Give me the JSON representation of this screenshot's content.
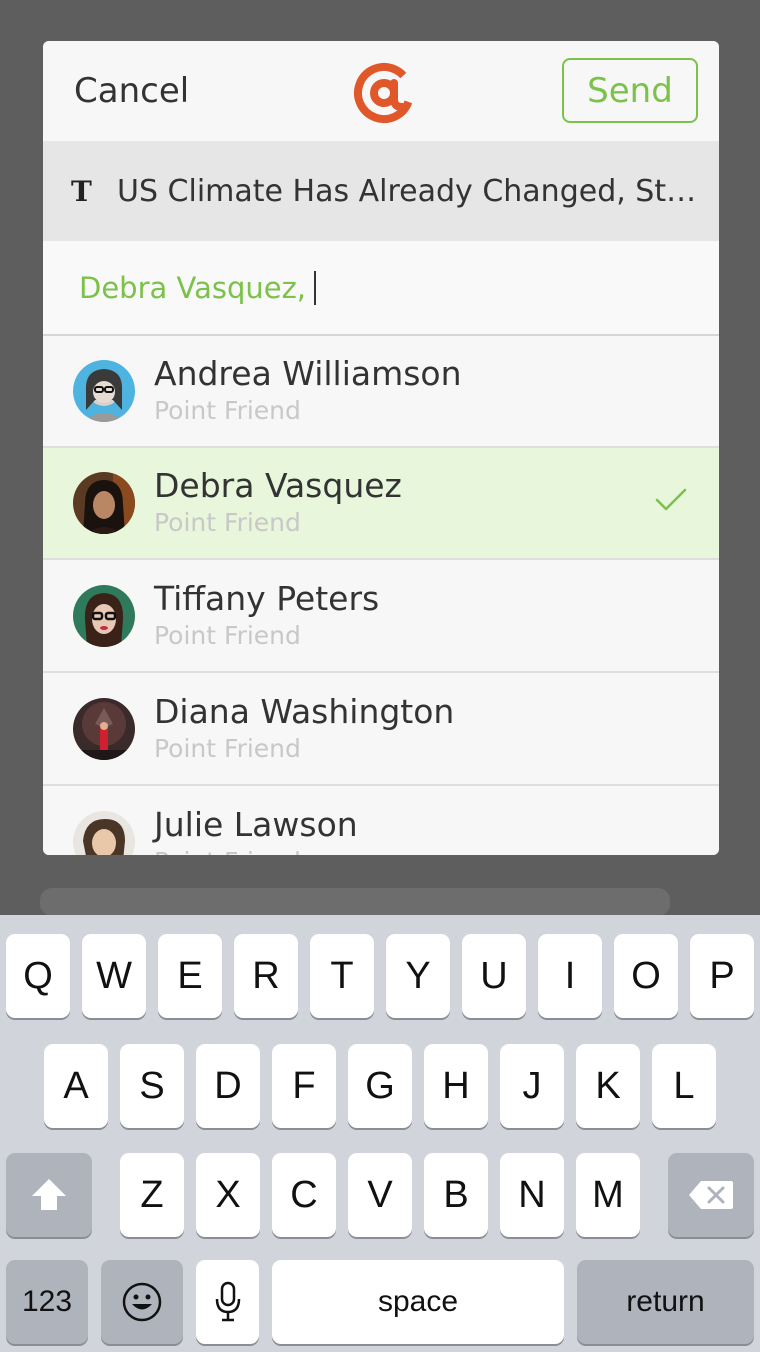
{
  "nav": {
    "cancel_label": "Cancel",
    "send_label": "Send",
    "logo_icon": "at-sign-icon",
    "accent_color": "#7cc14a",
    "logo_color": "#e0582a"
  },
  "article": {
    "source_icon": "nyt-logo-icon",
    "source_glyph": "T",
    "title": "US Climate Has Already Changed, Stu…"
  },
  "recipients": {
    "value": "Debra Vasquez,"
  },
  "contacts": [
    {
      "name": "Andrea Williamson",
      "subtitle": "Point Friend",
      "selected": false
    },
    {
      "name": "Debra Vasquez",
      "subtitle": "Point Friend",
      "selected": true
    },
    {
      "name": "Tiffany Peters",
      "subtitle": "Point Friend",
      "selected": false
    },
    {
      "name": "Diana Washington",
      "subtitle": "Point Friend",
      "selected": false
    },
    {
      "name": "Julie Lawson",
      "subtitle": "Point Friend",
      "selected": false
    }
  ],
  "keyboard": {
    "row1": [
      "Q",
      "W",
      "E",
      "R",
      "T",
      "Y",
      "U",
      "I",
      "O",
      "P"
    ],
    "row2": [
      "A",
      "S",
      "D",
      "F",
      "G",
      "H",
      "J",
      "K",
      "L"
    ],
    "row3": [
      "Z",
      "X",
      "C",
      "V",
      "B",
      "N",
      "M"
    ],
    "numbers_label": "123",
    "space_label": "space",
    "return_label": "return"
  }
}
